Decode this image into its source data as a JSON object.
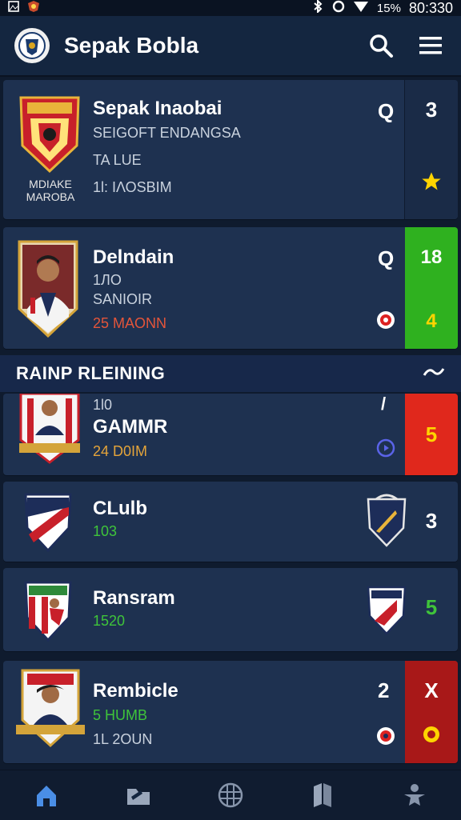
{
  "status_bar": {
    "time": "80:330",
    "battery": "15%"
  },
  "app": {
    "title": "Sepak Bobla"
  },
  "cards": [
    {
      "title": "Sepak Inaobai",
      "sub1": "SEIGOFT ENDANGSA",
      "sub2": "TA LUE",
      "sub3": "1Ɩ: ΙΛΟSΒΙΜ",
      "crest_caption": "MDIAKE\nMAROBA",
      "right_letter": "Q",
      "side_value": "3"
    },
    {
      "title": "Delndain",
      "sub1": "1ЛО",
      "sub2": "SANIOIR",
      "sub3": "25 MAONN",
      "right_letter": "Q",
      "side_value_top": "18",
      "side_value_bottom": "4"
    },
    {
      "sub1": "1Ɩ0",
      "title": "GAMMR",
      "sub3": "24 D0IM",
      "right_mark": "/",
      "side_value": "5"
    },
    {
      "title": "CLulb",
      "sub2": "103",
      "side_value": "3"
    },
    {
      "title": "Ransram",
      "sub2": "1520",
      "side_value": "5"
    },
    {
      "title": "Rembicle",
      "sub1": "5 HUMB",
      "sub2": "1L 2OUN",
      "right_value": "2",
      "side_mark": "X"
    }
  ],
  "section": {
    "label": "RAINP RLEINING"
  },
  "colors": {
    "background": "#0f1b2e",
    "card": "#1e3150",
    "green": "#2fb11f",
    "red": "#e0281c",
    "maroon": "#a81818",
    "accent_yellow": "#ffd400"
  },
  "icons": [
    "image-icon",
    "shield-small-icon",
    "bluetooth-icon",
    "alarm-icon",
    "wifi-icon",
    "search-icon",
    "menu-icon",
    "star-icon",
    "home-icon",
    "folder-icon",
    "grid-icon",
    "book-icon",
    "player-icon"
  ]
}
